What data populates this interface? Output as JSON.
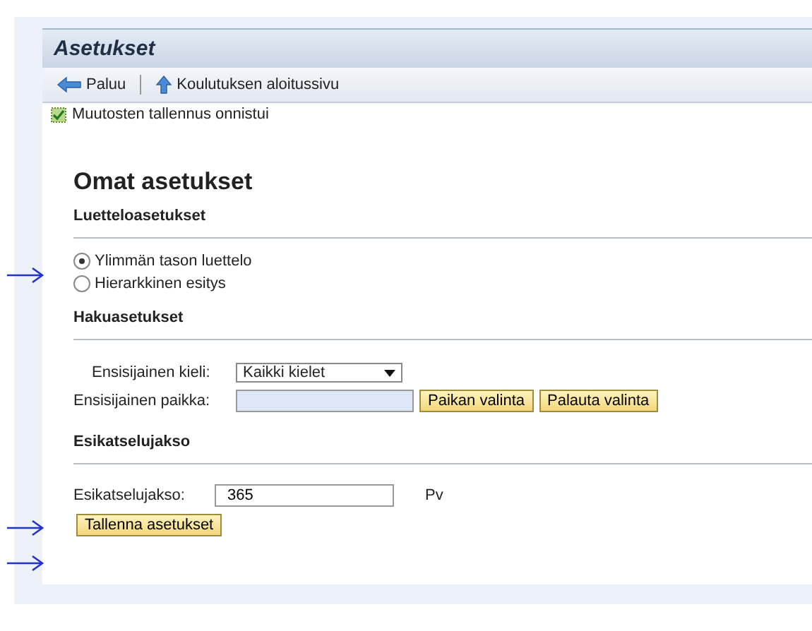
{
  "window": {
    "title": "Asetukset"
  },
  "toolbar": [
    {
      "kind": "back",
      "label": "Paluu"
    },
    {
      "kind": "home",
      "label": "Koulutuksen aloitussivu"
    }
  ],
  "message": {
    "text": "Muutosten tallennus onnistui",
    "checked": true
  },
  "page_title": "Omat asetukset",
  "list_settings": {
    "heading": "Luetteloasetukset",
    "options": [
      {
        "label": "Ylimmän tason luettelo",
        "selected": true
      },
      {
        "label": "Hierarkkinen esitys",
        "selected": false
      }
    ]
  },
  "search_settings": {
    "heading": "Hakuasetukset",
    "language_label": "Ensisijainen kieli:",
    "language_value": "Kaikki kielet",
    "place_label": "Ensisijainen paikka:",
    "buttons": [
      "Paikan valinta",
      "Palauta valinta"
    ]
  },
  "preview": {
    "heading": "Esikatselujakso",
    "label": "Esikatselujakso:",
    "value": "365",
    "unit": "Pv"
  },
  "save_button": "Tallenna asetukset"
}
